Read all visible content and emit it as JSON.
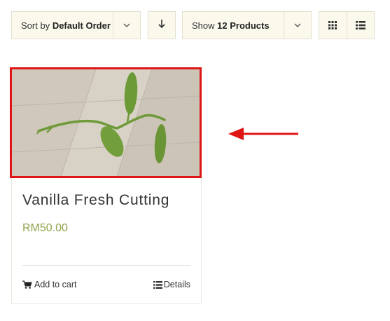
{
  "toolbar": {
    "sort_prefix": "Sort by",
    "sort_value": "Default Order",
    "show_prefix": "Show",
    "show_value": "12 Products"
  },
  "icons": {
    "sort_chevron": "chevron-down-icon",
    "sort_direction": "arrow-down-icon",
    "show_chevron": "chevron-down-icon",
    "grid_view": "grid-icon",
    "list_view": "list-icon",
    "cart": "cart-icon",
    "details": "list-icon",
    "annotation": "arrow-left-icon"
  },
  "product": {
    "title": "Vanilla Fresh Cutting",
    "price": "RM50.00",
    "add_to_cart": "Add to cart",
    "details": "Details"
  },
  "colors": {
    "toolbar_bg": "#fbf8ec",
    "price": "#8ea44a",
    "highlight": "#e01616",
    "leaf": "#6f9a3a"
  }
}
